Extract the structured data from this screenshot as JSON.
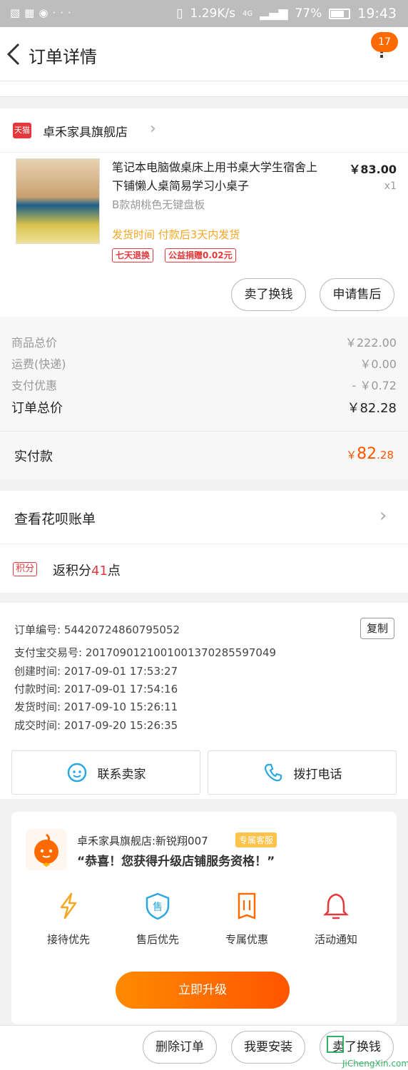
{
  "status_bar": {
    "speed": "1.29K/s",
    "network": "4G",
    "battery": "77%",
    "time": "19:43"
  },
  "header": {
    "title": "订单详情",
    "badge": "17"
  },
  "shop": {
    "badge": "天猫",
    "name": "卓禾家具旗舰店"
  },
  "product": {
    "name": "笔记本电脑做桌床上用书桌大学生宿舍上下铺懒人桌简易学习小桌子",
    "spec": "B款胡桃色无键盘板",
    "price": "￥83.00",
    "qty": "x1",
    "shipping": "发货时间 付款后3天内发货",
    "tags": [
      "七天退换",
      "公益捐赠0.02元"
    ],
    "buttons": [
      "卖了换钱",
      "申请售后"
    ]
  },
  "summary": {
    "rows": [
      {
        "label": "商品总价",
        "value": "￥222.00"
      },
      {
        "label": "运费(快递)",
        "value": "￥0.00"
      },
      {
        "label": "支付优惠",
        "value": "- ￥0.72"
      }
    ],
    "total_label": "订单总价",
    "total_value": "￥82.28",
    "paid_label": "实付款",
    "paid_symbol": "￥",
    "paid_int": "82",
    "paid_dec": ".28"
  },
  "huabei": {
    "label": "查看花呗账单"
  },
  "points": {
    "badge": "积分",
    "prefix": "返积分",
    "num": "41",
    "suffix": "点"
  },
  "order_info": {
    "rows": [
      "订单编号: 54420724860795052",
      "支付宝交易号: 2017090121001001370285597049",
      "创建时间: 2017-09-01 17:53:27",
      "付款时间: 2017-09-01 17:54:16",
      "发货时间: 2017-09-10 15:26:11",
      "成交时间: 2017-09-20 15:26:35"
    ],
    "copy": "复制"
  },
  "contact": {
    "seller": "联系卖家",
    "phone": "拨打电话"
  },
  "upgrade": {
    "service": "卓禾家具旗舰店:新锐翔007",
    "service_tag": "专属客服",
    "message": "“恭喜！您获得升级店铺服务资格！”",
    "benefits": [
      "接待优先",
      "售后优先",
      "专属优惠",
      "活动通知"
    ],
    "button": "立即升级"
  },
  "bottom": {
    "buttons": [
      "删除订单",
      "我要安装",
      "卖了换钱"
    ]
  },
  "watermark": {
    "text": "JiChengXin.com"
  },
  "colors": {
    "accent": "#ff6a00",
    "price": "#ff5500",
    "tmall": "#e4393c",
    "ship": "#f5a623"
  }
}
